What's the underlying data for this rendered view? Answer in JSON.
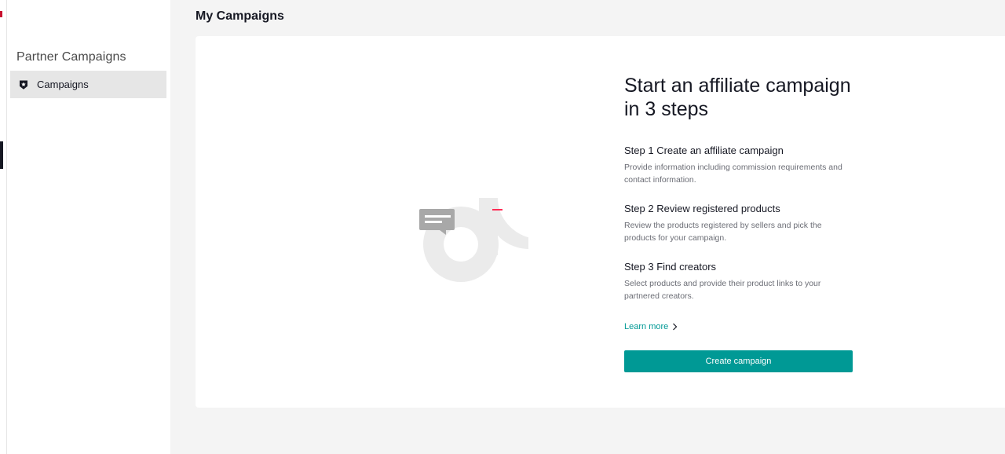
{
  "sidebar": {
    "section_title": "Partner Campaigns",
    "items": [
      {
        "label": "Campaigns",
        "icon": "shield-star-icon",
        "active": true
      }
    ]
  },
  "header": {
    "title": "My Campaigns"
  },
  "main": {
    "headline": "Start an affiliate campaign in 3 steps",
    "steps": [
      {
        "title": "Step 1 Create an affiliate campaign",
        "description": "Provide information including commission requirements and contact information."
      },
      {
        "title": "Step 2 Review registered products",
        "description": "Review the products registered by sellers and pick the products for your campaign."
      },
      {
        "title": "Step 3 Find creators",
        "description": "Select products and provide their product links to your partnered creators."
      }
    ],
    "learn_more": "Learn more",
    "cta_label": "Create campaign"
  },
  "colors": {
    "accent": "#009995",
    "active_nav_bg": "#e6e6e6",
    "page_bg": "#f4f4f4",
    "brand_red": "#fe2c55",
    "figure_teal": "#3ad6d0"
  }
}
